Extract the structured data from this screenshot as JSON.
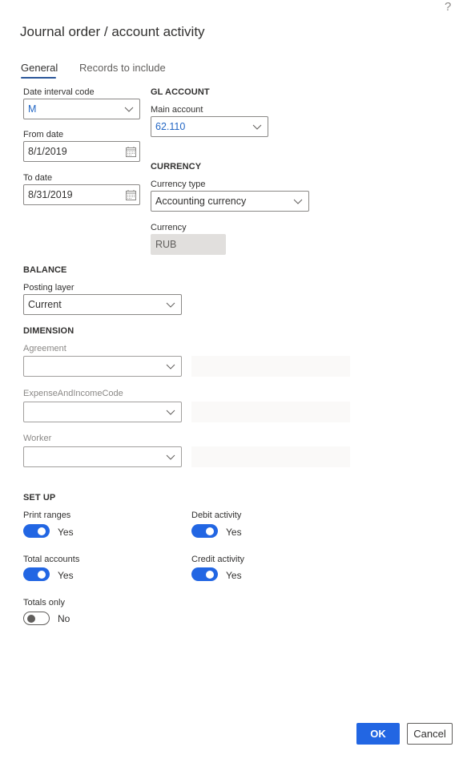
{
  "dialog": {
    "title": "Journal order / account activity",
    "help_icon": "?"
  },
  "tabs": [
    {
      "label": "General",
      "selected": true
    },
    {
      "label": "Records to include",
      "selected": false
    }
  ],
  "general": {
    "date_interval_code": {
      "label": "Date interval code",
      "value": "M"
    },
    "from_date": {
      "label": "From date",
      "value": "8/1/2019"
    },
    "to_date": {
      "label": "To date",
      "value": "8/31/2019"
    }
  },
  "gl_account": {
    "heading": "GL ACCOUNT",
    "main_account": {
      "label": "Main account",
      "value": "62.110"
    }
  },
  "currency": {
    "heading": "CURRENCY",
    "currency_type": {
      "label": "Currency type",
      "value": "Accounting currency"
    },
    "currency": {
      "label": "Currency",
      "value": "RUB"
    }
  },
  "balance": {
    "heading": "BALANCE",
    "posting_layer": {
      "label": "Posting layer",
      "value": "Current"
    }
  },
  "dimension": {
    "heading": "DIMENSION",
    "fields": [
      {
        "label": "Agreement",
        "value": ""
      },
      {
        "label": "ExpenseAndIncomeCode",
        "value": ""
      },
      {
        "label": "Worker",
        "value": ""
      }
    ]
  },
  "setup": {
    "heading": "SET UP",
    "print_ranges": {
      "label": "Print ranges",
      "on": true,
      "text": "Yes"
    },
    "total_accounts": {
      "label": "Total accounts",
      "on": true,
      "text": "Yes"
    },
    "totals_only": {
      "label": "Totals only",
      "on": false,
      "text": "No"
    },
    "debit_activity": {
      "label": "Debit activity",
      "on": true,
      "text": "Yes"
    },
    "credit_activity": {
      "label": "Credit activity",
      "on": true,
      "text": "Yes"
    }
  },
  "buttons": {
    "ok": "OK",
    "cancel": "Cancel"
  },
  "colors": {
    "accent": "#2266e3",
    "link_value": "#2266c4",
    "tab_underline": "#2b579a"
  }
}
